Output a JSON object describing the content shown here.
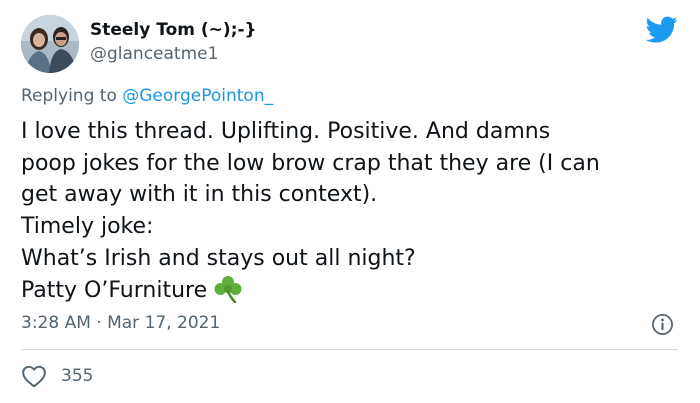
{
  "user": {
    "display_name": "Steely Tom (~);-}",
    "handle": "@glanceatme1",
    "avatar_icon": "avatar-photo"
  },
  "reply": {
    "prefix": "Replying to",
    "mention": "@GeorgePointon_"
  },
  "tweet": {
    "lines": [
      "I love this thread.  Uplifting. Positive. And damns",
      "poop jokes for the low brow crap that they are (I can",
      "get away with it in this context).",
      "Timely joke:",
      "What’s Irish and stays out all night?",
      "Patty O’Furniture"
    ],
    "emoji": "shamrock-icon"
  },
  "meta": {
    "timestamp": "3:28 AM · Mar 17, 2021",
    "like_count": "355"
  },
  "colors": {
    "text": "#0f1419",
    "secondary": "#536471",
    "accent": "#1b95e0",
    "divider": "#cfd9de"
  },
  "icons": {
    "brand": "twitter-bird-icon",
    "info": "info-icon",
    "like": "heart-icon"
  }
}
